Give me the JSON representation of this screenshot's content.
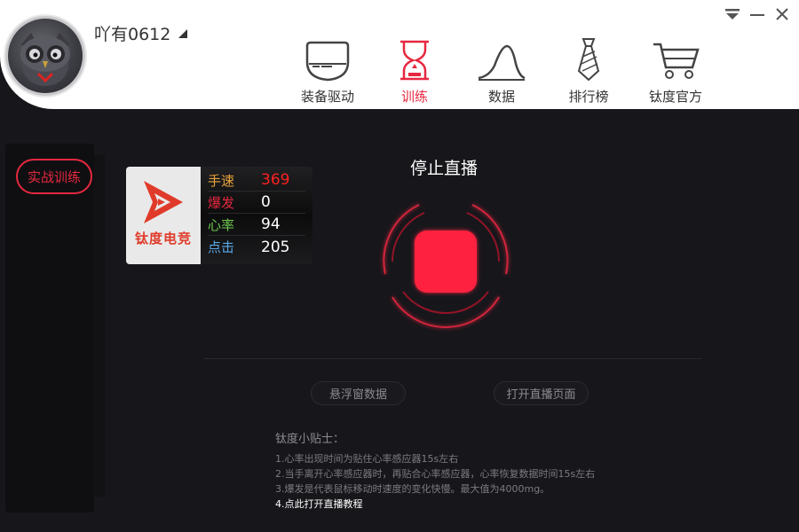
{
  "user": {
    "name": "吖有0612"
  },
  "nav": {
    "items": [
      {
        "label": "装备驱动",
        "icon": "device-icon"
      },
      {
        "label": "训练",
        "icon": "hourglass-icon",
        "active": true
      },
      {
        "label": "数据",
        "icon": "wave-chart-icon"
      },
      {
        "label": "排行榜",
        "icon": "tie-icon"
      },
      {
        "label": "钛度官方",
        "icon": "cart-icon"
      }
    ]
  },
  "sidebar": {
    "button_label": "实战训练"
  },
  "card": {
    "logo_text": "钛度电竞",
    "stats": [
      {
        "label": "手速",
        "value": "369"
      },
      {
        "label": "爆发",
        "value": "0"
      },
      {
        "label": "心率",
        "value": "94"
      },
      {
        "label": "点击",
        "value": "205"
      }
    ]
  },
  "live": {
    "title": "停止直播",
    "float_button": "悬浮窗数据",
    "open_page_button": "打开直播页面"
  },
  "tips": {
    "title": "钛度小贴士：",
    "lines": [
      "1.心率出现时间为贴住心率感应器15s左右",
      "2.当手离开心率感应器时，再贴合心率感应器，心率恢复数据时间15s左右",
      "3.爆发是代表鼠标移动时速度的变化快慢。最大值为4000mg。"
    ],
    "link": "4.点此打开直播教程"
  },
  "colors": {
    "accent": "#e6283f",
    "background": "#17171b",
    "header": "#ffffff"
  }
}
